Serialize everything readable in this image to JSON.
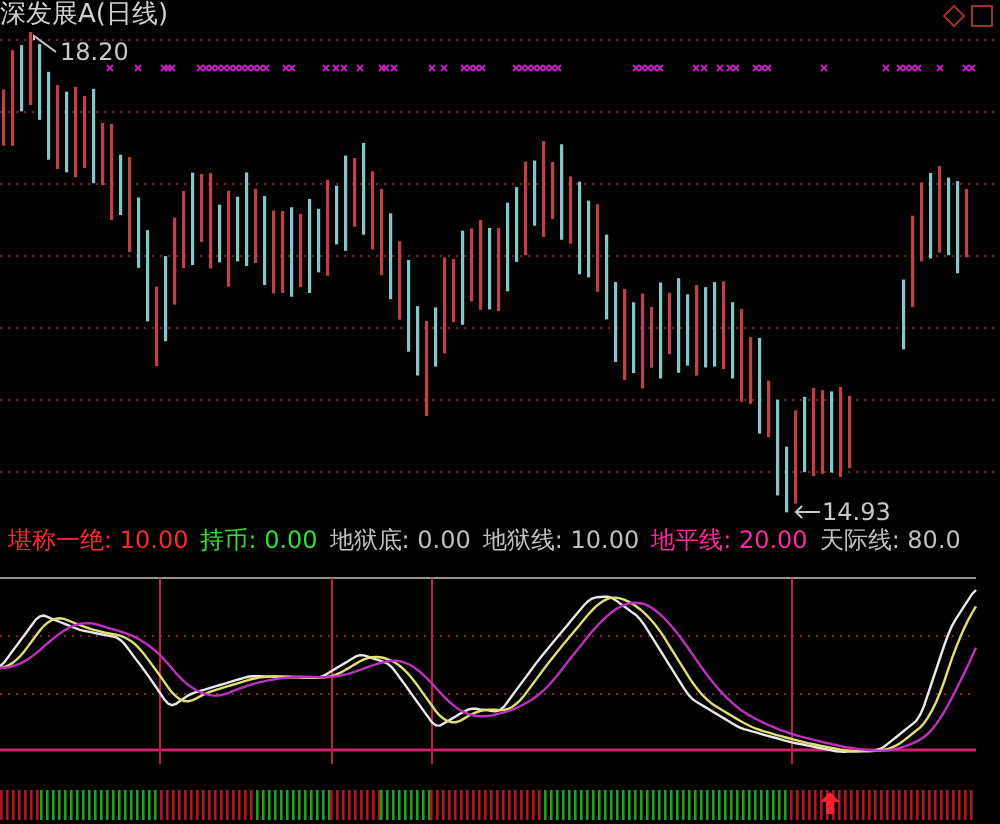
{
  "title": "深发展A(日线)",
  "price_labels": {
    "high": "18.20",
    "low": "14.93"
  },
  "legend": [
    {
      "label": "堪称一绝:",
      "value": "10.00",
      "color": "#ff2a2a"
    },
    {
      "label": "持币:",
      "value": "0.00",
      "color": "#33e033"
    },
    {
      "label": "地狱底:",
      "value": "0.00",
      "color": "#c0c0c0"
    },
    {
      "label": "地狱线:",
      "value": "10.00",
      "color": "#c0c0c0"
    },
    {
      "label": "地平线:",
      "value": "20.00",
      "color": "#ff2aa0"
    },
    {
      "label": "天际线:",
      "value": "80.0",
      "color": "#c0c0c0"
    }
  ]
}
